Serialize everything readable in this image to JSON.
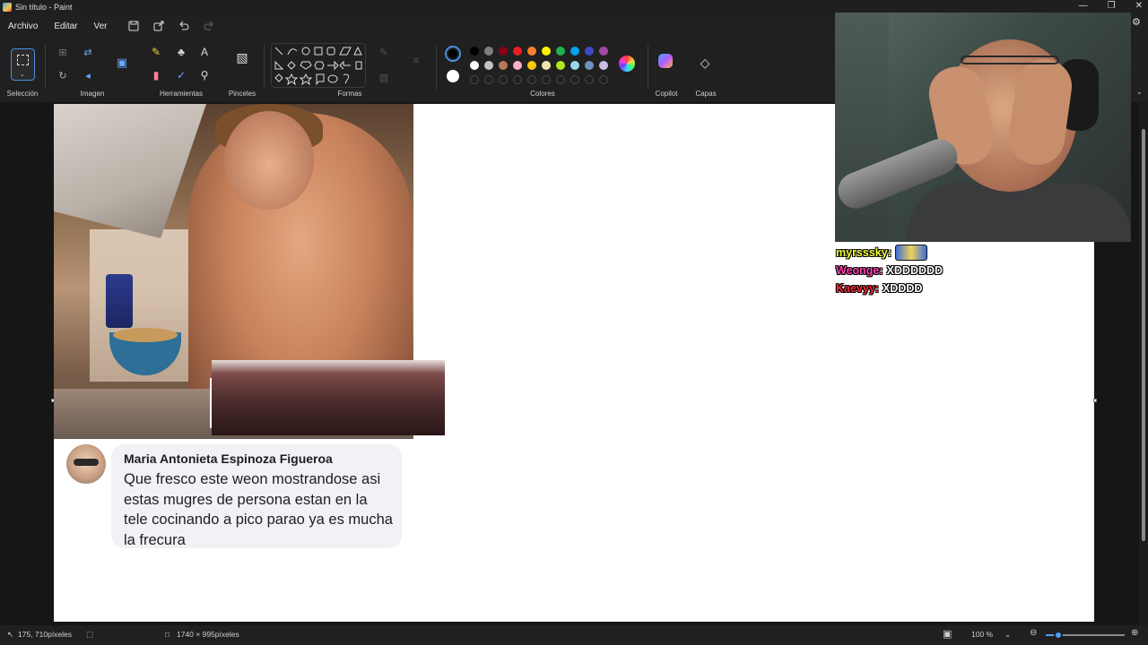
{
  "window": {
    "title": "Sin título - Paint"
  },
  "menu": {
    "items": [
      "Archivo",
      "Editar",
      "Ver"
    ]
  },
  "ribbon": {
    "groups": {
      "selection": "Selección",
      "image": "Imagen",
      "tools": "Herramientas",
      "brushes": "Pinceles",
      "shapes": "Formas",
      "colors": "Colores",
      "copilot": "Copilot",
      "layers": "Capas"
    },
    "palette_row1": [
      "#000000",
      "#7f7f7f",
      "#880015",
      "#ed1c24",
      "#ff7f27",
      "#fff200",
      "#22b14c",
      "#00a2e8",
      "#3f48cc",
      "#a349a4"
    ],
    "palette_row2": [
      "#ffffff",
      "#c3c3c3",
      "#b97a57",
      "#ffaec9",
      "#ffc90e",
      "#efe4b0",
      "#b5e61d",
      "#99d9ea",
      "#7092be",
      "#c8bfe7"
    ],
    "primary_color": "#000000",
    "secondary_color": "#ffffff"
  },
  "comment": {
    "author": "Maria Antonieta Espinoza Figueroa",
    "text": "Que fresco este weon  mostrandose asi estas mugres de persona estan en la tele cocinando a pico parao ya es mucha la frecura"
  },
  "chat": [
    {
      "user": "myrsssky:",
      "color": "#f5ff3a",
      "message": ""
    },
    {
      "user": "Weonge:",
      "color": "#ff3fb3",
      "message": "XDDDDDD"
    },
    {
      "user": "Kaevyy:",
      "color": "#ff2a3a",
      "message": "XDDDD"
    }
  ],
  "status": {
    "cursor_position": "175, 710píxeles",
    "canvas_size": "1740 × 995píxeles",
    "zoom": "100 %"
  }
}
